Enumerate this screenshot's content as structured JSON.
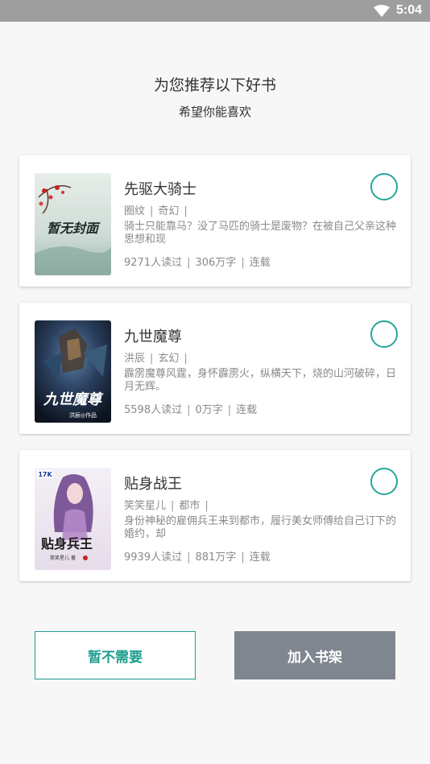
{
  "status_bar": {
    "time": "5:04",
    "wifi_icon": "wifi-icon"
  },
  "header": {
    "title": "为您推荐以下好书",
    "subtitle": "希望你能喜欢"
  },
  "books": [
    {
      "title": "先驱大骑士",
      "author": "圈纹",
      "genre": "奇幻",
      "description": "骑士只能靠马？没了马匹的骑士是废物？在被自己父亲这种思想和现",
      "readers": "9271人读过",
      "words": "306万字",
      "status": "连载",
      "cover_text": "暂无封面"
    },
    {
      "title": "九世魔尊",
      "author": "洪辰",
      "genre": "玄幻",
      "description": "霹雳魔尊风霆，身怀霹雳火，纵横天下，烧的山河破碎，日月无辉。",
      "readers": "5598人读过",
      "words": "0万字",
      "status": "连载",
      "cover_text": "九世魔尊",
      "cover_subtext": "洪辰◎作品"
    },
    {
      "title": "贴身战王",
      "author": "笑笑星儿",
      "genre": "都市",
      "description": "身份神秘的雇佣兵王来到都市，履行美女师傅给自己订下的婚约，却",
      "readers": "9939人读过",
      "words": "881万字",
      "status": "连载",
      "cover_text": "贴身兵王",
      "cover_badge": "17K",
      "cover_subtext": "笑笑星儿 著"
    }
  ],
  "buttons": {
    "skip": "暂不需要",
    "add": "加入书架"
  },
  "colors": {
    "accent": "#26a69a",
    "add_button_bg": "#808690"
  }
}
